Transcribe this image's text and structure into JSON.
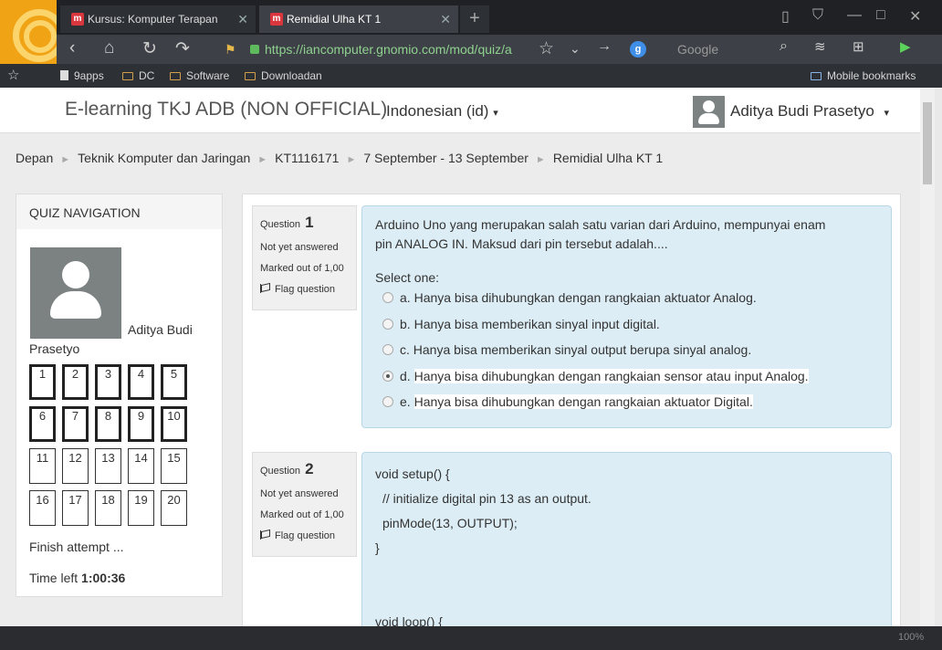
{
  "browser": {
    "tabs": [
      {
        "label": "Kursus: Komputer Terapan",
        "active": false
      },
      {
        "label": "Remidial Ulha KT 1",
        "active": true
      }
    ],
    "url": "https://iancomputer.gnomio.com/mod/quiz/a",
    "search_engine": "Google",
    "bookmarks": [
      "9apps",
      "DC",
      "Software",
      "Downloadan"
    ],
    "mobile_bookmarks": "Mobile bookmarks",
    "zoom": "100%"
  },
  "header": {
    "site_name": "E-learning TKJ ADB (NON OFFICIAL)",
    "language": "Indonesian (id)",
    "user_name": "Aditya Budi Prasetyo"
  },
  "breadcrumb": [
    "Depan",
    "Teknik Komputer dan Jaringan",
    "KT1116171",
    "7 September - 13 September",
    "Remidial Ulha KT 1"
  ],
  "quiz_nav": {
    "title": "QUIZ NAVIGATION",
    "user_line1": "Aditya Budi",
    "user_line2": "Prasetyo",
    "buttons": [
      {
        "n": "1",
        "answered": true
      },
      {
        "n": "2",
        "answered": true
      },
      {
        "n": "3",
        "answered": true
      },
      {
        "n": "4",
        "answered": true
      },
      {
        "n": "5",
        "answered": true
      },
      {
        "n": "6",
        "answered": true
      },
      {
        "n": "7",
        "answered": true
      },
      {
        "n": "8",
        "answered": true
      },
      {
        "n": "9",
        "answered": true
      },
      {
        "n": "10",
        "answered": true
      },
      {
        "n": "11",
        "answered": false
      },
      {
        "n": "12",
        "answered": false
      },
      {
        "n": "13",
        "answered": false
      },
      {
        "n": "14",
        "answered": false
      },
      {
        "n": "15",
        "answered": false
      },
      {
        "n": "16",
        "answered": false
      },
      {
        "n": "17",
        "answered": false
      },
      {
        "n": "18",
        "answered": false
      },
      {
        "n": "19",
        "answered": false
      },
      {
        "n": "20",
        "answered": false
      }
    ],
    "finish_label": "Finish attempt ...",
    "time_left_label": "Time left",
    "time_left_value": "1:00:36"
  },
  "questions": [
    {
      "label": "Question",
      "number": "1",
      "status": "Not yet answered",
      "marked": "Marked out of 1,00",
      "flag": "Flag question",
      "text": "Arduino Uno yang merupakan salah satu varian dari Arduino, mempunyai enam pin ANALOG IN. Maksud dari pin tersebut adalah....",
      "select_label": "Select one:",
      "options": [
        {
          "letter": "a.",
          "text": "Hanya bisa dihubungkan dengan rangkaian aktuator Analog.",
          "checked": false
        },
        {
          "letter": "b.",
          "text": "Hanya bisa memberikan sinyal input digital.",
          "checked": false
        },
        {
          "letter": "c.",
          "text": "Hanya bisa memberikan sinyal output berupa sinyal analog.",
          "checked": false
        },
        {
          "letter": "d.",
          "text": "Hanya bisa dihubungkan dengan rangkaian  sensor atau input Analog.",
          "checked": true
        },
        {
          "letter": "e.",
          "text": "Hanya bisa dihubungkan dengan rangkaian aktuator Digital.",
          "checked": false
        }
      ]
    },
    {
      "label": "Question",
      "number": "2",
      "status": "Not yet answered",
      "marked": "Marked out of 1,00",
      "flag": "Flag question",
      "code": [
        "void setup() {",
        "// initialize digital pin 13 as an output.",
        "pinMode(13, OUTPUT);",
        "}",
        "",
        "",
        "void loop() {"
      ]
    }
  ]
}
